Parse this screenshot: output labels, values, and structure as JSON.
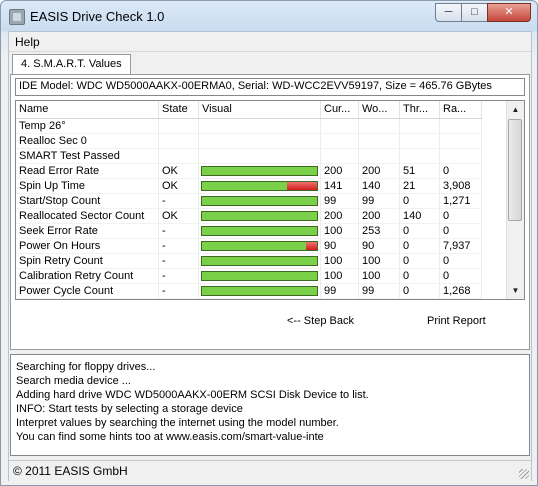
{
  "window": {
    "title": "EASIS Drive Check 1.0",
    "min_glyph": "─",
    "max_glyph": "□",
    "close_glyph": "✕"
  },
  "menu": {
    "help": "Help"
  },
  "tab": {
    "label": "4. S.M.A.R.T. Values"
  },
  "model_line": "IDE Model: WDC WD5000AAKX-00ERMA0, Serial: WD-WCC2EVV59197, Size = 465.76 GBytes",
  "columns": [
    "Name",
    "State",
    "Visual",
    "Cur...",
    "Wo...",
    "Thr...",
    "Ra..."
  ],
  "rows": [
    {
      "name": "Temp 26°",
      "state": "",
      "bar": null,
      "cur": "",
      "worst": "",
      "thr": "",
      "raw": ""
    },
    {
      "name": "Realloc Sec 0",
      "state": "",
      "bar": null,
      "cur": "",
      "worst": "",
      "thr": "",
      "raw": ""
    },
    {
      "name": "SMART Test Passed",
      "state": "",
      "bar": null,
      "cur": "",
      "worst": "",
      "thr": "",
      "raw": ""
    },
    {
      "name": "Read Error Rate",
      "state": "OK",
      "bar": 1.0,
      "cur": "200",
      "worst": "200",
      "thr": "51",
      "raw": "0"
    },
    {
      "name": "Spin Up Time",
      "state": "OK",
      "bar": 0.74,
      "cur": "141",
      "worst": "140",
      "thr": "21",
      "raw": "3,908"
    },
    {
      "name": "Start/Stop Count",
      "state": "-",
      "bar": 1.0,
      "cur": "99",
      "worst": "99",
      "thr": "0",
      "raw": "1,271"
    },
    {
      "name": "Reallocated Sector Count",
      "state": "OK",
      "bar": 1.0,
      "cur": "200",
      "worst": "200",
      "thr": "140",
      "raw": "0"
    },
    {
      "name": "Seek Error Rate",
      "state": "-",
      "bar": 1.0,
      "cur": "100",
      "worst": "253",
      "thr": "0",
      "raw": "0"
    },
    {
      "name": "Power On Hours",
      "state": "-",
      "bar": 0.9,
      "cur": "90",
      "worst": "90",
      "thr": "0",
      "raw": "7,937"
    },
    {
      "name": "Spin Retry Count",
      "state": "-",
      "bar": 1.0,
      "cur": "100",
      "worst": "100",
      "thr": "0",
      "raw": "0"
    },
    {
      "name": "Calibration Retry Count",
      "state": "-",
      "bar": 1.0,
      "cur": "100",
      "worst": "100",
      "thr": "0",
      "raw": "0"
    },
    {
      "name": "Power Cycle Count",
      "state": "-",
      "bar": 1.0,
      "cur": "99",
      "worst": "99",
      "thr": "0",
      "raw": "1,268"
    }
  ],
  "buttons": {
    "step_back": "<-- Step Back",
    "print_report": "Print Report"
  },
  "log": [
    "Searching for floppy drives...",
    "Search media device ...",
    "Adding hard drive WDC WD5000AAKX-00ERM SCSI Disk Device to list.",
    "INFO: Start tests by selecting a storage device",
    "Interpret values by searching the internet using the model number.",
    "You can find some hints too at www.easis.com/smart-value-inte"
  ],
  "status": "© 2011 EASIS GmbH",
  "colors": {
    "bar_ok": "#7bd04a",
    "bar_bad": "#d21e1e"
  }
}
